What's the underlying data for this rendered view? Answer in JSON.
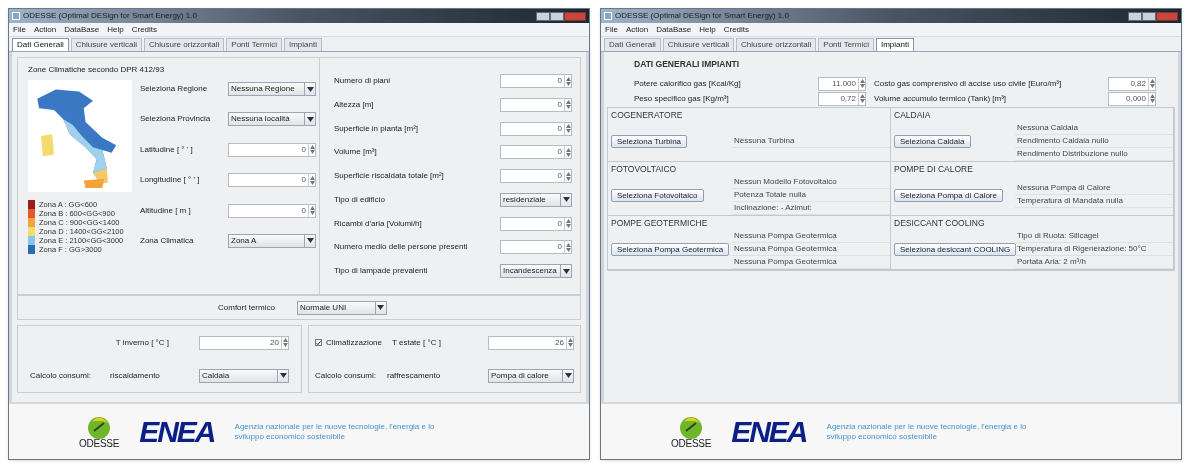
{
  "windows": [
    {
      "kind": "general",
      "title": "ODESSE (Optimal DESign for Smart Energy) 1.0",
      "menu": [
        "File",
        "Action",
        "DataBase",
        "Help",
        "Credits"
      ],
      "tabs": [
        {
          "label": "Dati Generali",
          "selected": true
        },
        {
          "label": "Chiusure verticali",
          "selected": false
        },
        {
          "label": "Chiusure orizzontali",
          "selected": false
        },
        {
          "label": "Ponti Termici",
          "selected": false
        },
        {
          "label": "Impianti",
          "selected": false
        }
      ],
      "general": {
        "map_title": "Zone Climatiche secondo DPR 412/93",
        "legend": [
          {
            "label": "Zona A : GG<600",
            "color": "#9b1c1c"
          },
          {
            "label": "Zona B : 600<GG<900",
            "color": "#e2572b"
          },
          {
            "label": "Zona C : 900<GG<1400",
            "color": "#f2a33a"
          },
          {
            "label": "Zona D : 1400<GG<2100",
            "color": "#f2dc6e"
          },
          {
            "label": "Zona E : 2100<GG<3000",
            "color": "#8cc4e8"
          },
          {
            "label": "Zona F : GG>3000",
            "color": "#2a6bb5"
          }
        ],
        "location_fields": [
          {
            "label": "Seleziona Regione",
            "kind": "dropdown",
            "value": "Nessuna Regione"
          },
          {
            "label": "Seleziona Provincia",
            "kind": "dropdown",
            "value": "Nessuna località"
          },
          {
            "label": "Latitudine [ ° ' ]",
            "kind": "spinner",
            "value": "0"
          },
          {
            "label": "Longitudine [ ° ' ]",
            "kind": "spinner",
            "value": "0"
          },
          {
            "label": "Altitudine [ m ]",
            "kind": "spinner",
            "value": "0"
          },
          {
            "label": "Zona Climatica",
            "kind": "dropdown",
            "value": "Zona A"
          }
        ],
        "building_fields": [
          {
            "label": "Numero di piani",
            "kind": "spinner",
            "value": "0"
          },
          {
            "label": "Altezza [m]",
            "kind": "spinner",
            "value": "0"
          },
          {
            "label": "Superficie in pianta [m²]",
            "kind": "spinner",
            "value": "0"
          },
          {
            "label": "Volume [m³]",
            "kind": "spinner",
            "value": "0"
          },
          {
            "label": "Superficie riscaldata totale [m²]",
            "kind": "spinner",
            "value": "0"
          },
          {
            "label": "Tipo di edificio",
            "kind": "dropdown",
            "value": "residenziale"
          },
          {
            "label": "Ricambi d'aria [Volumi/h]",
            "kind": "spinner",
            "value": "0"
          },
          {
            "label": "Numero medio delle persone presenti",
            "kind": "spinner",
            "value": "0"
          },
          {
            "label": "Tipo di lampade prevalenti",
            "kind": "dropdown",
            "value": "Incandescenza"
          }
        ],
        "comfort": {
          "label": "Comfort termico",
          "value": "Normale UNI"
        },
        "winter": {
          "temp_label": "T inverno [ °C ]",
          "temp_value": "20",
          "consumption_label": "Calcolo consumi:",
          "use_label": "riscaldamento",
          "use_value": "Caldaia"
        },
        "summer": {
          "checkbox_label": "Climatizzazione",
          "checked": true,
          "temp_label": "T estate [ °C ]",
          "temp_value": "26",
          "consumption_label": "Calcolo consumi:",
          "use_label": "raffrescamento",
          "use_value": "Pompa di calore"
        }
      },
      "footer": {
        "odesse": "ODESSE",
        "enea": "ENEA",
        "tagline": "Agenzia nazionale per le nuove tecnologie, l'energia e lo sviluppo economico sostenibile"
      }
    },
    {
      "kind": "plants",
      "title": "ODESSE (Optimal DESign for Smart Energy) 1.0",
      "menu": [
        "File",
        "Action",
        "DataBase",
        "Help",
        "Credits"
      ],
      "tabs": [
        {
          "label": "Dati Generali",
          "selected": false
        },
        {
          "label": "Chiusure verticali",
          "selected": false
        },
        {
          "label": "Chiusure orizzontali",
          "selected": false
        },
        {
          "label": "Ponti Termici",
          "selected": false
        },
        {
          "label": "Impianti",
          "selected": true
        }
      ],
      "plants": {
        "title": "DATI GENERALI IMPIANTI",
        "fields": [
          {
            "label": "Potere calorifico gas [Kcal/Kg]",
            "value": "11.000"
          },
          {
            "label": "Costo gas comprensivo di accise uso civile [Euro/m³]",
            "value": "0,82"
          },
          {
            "label": "Peso specifico gas [Kg/m³]",
            "value": "0,72"
          },
          {
            "label": "Volume accumulo termico (Tank) [m³]",
            "value": "0,000"
          }
        ],
        "sections": [
          {
            "title": "COGENERATORE",
            "button": "Seleziona Turbina",
            "lines": [
              "Nessuna Turbina"
            ]
          },
          {
            "title": "CALDAIA",
            "button": "Seleziona Caldaia",
            "lines": [
              "Nessuna Caldaia",
              "Rendimento Caldaia nullo",
              "Rendimento Distribuzione nullo"
            ]
          },
          {
            "title": "FOTOVOLTAICO",
            "button": "Seleziona Fotovoltaico",
            "lines": [
              "Nessun Modello Fotovoltaico",
              "Potenza Totale nulla",
              "Inclinazione: - Azimut:"
            ]
          },
          {
            "title": "POMPE DI CALORE",
            "button": "Seleziona Pompa di Calore",
            "lines": [
              "Nessuna Pompa di Calore",
              "Temperatura di Mandata nulla"
            ]
          },
          {
            "title": "POMPE GEOTERMICHE",
            "button": "Seleziona Pompa Geotermica",
            "lines": [
              "Nessuna Pompa Geotermica",
              "Nessuna Pompa Geotermica",
              "Nessuna Pompa Geotermica"
            ]
          },
          {
            "title": "DESICCANT COOLING",
            "button": "Seleziona desiccant COOLING",
            "lines": [
              "Tipo di Ruota: Silicagel",
              "Temperatura di Rigenerazione: 50°C",
              "Portata Aria: 2 m³/h"
            ]
          }
        ]
      },
      "footer": {
        "odesse": "ODESSE",
        "enea": "ENEA",
        "tagline": "Agenzia nazionale per le nuove tecnologie, l'energia e lo sviluppo economico sostenibile"
      }
    }
  ]
}
